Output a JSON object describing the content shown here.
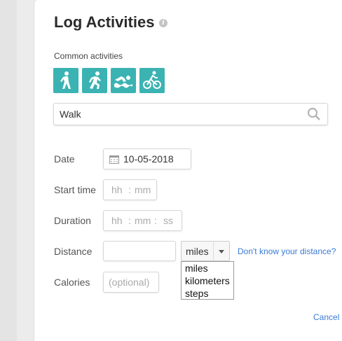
{
  "header": {
    "title": "Log Activities",
    "info_icon": "info-icon"
  },
  "activities": {
    "label": "Common activities",
    "items": [
      {
        "name": "walk",
        "icon": "walking-person-icon"
      },
      {
        "name": "run",
        "icon": "running-person-icon"
      },
      {
        "name": "swim",
        "icon": "swimming-person-icon"
      },
      {
        "name": "bike",
        "icon": "cyclist-icon"
      }
    ]
  },
  "search": {
    "value": "Walk",
    "icon": "search-icon"
  },
  "form": {
    "date": {
      "label": "Date",
      "value": "10-05-2018",
      "icon": "calendar-icon"
    },
    "start_time": {
      "label": "Start time",
      "hh": "hh",
      "sep": ":",
      "mm": "mm"
    },
    "duration": {
      "label": "Duration",
      "hh": "hh",
      "sep1": ":",
      "mm": "mm",
      "sep2": ":",
      "ss": "ss"
    },
    "distance": {
      "label": "Distance",
      "value": "",
      "unit_selected": "miles",
      "unit_options": [
        "miles",
        "kilometers",
        "steps"
      ],
      "help_link": "Don't know your distance?"
    },
    "calories": {
      "label": "Calories",
      "placeholder": "(optional)"
    }
  },
  "footer": {
    "cancel_label": "Cancel"
  },
  "colors": {
    "accent": "#3bb3b3",
    "link": "#3a7bd5"
  }
}
